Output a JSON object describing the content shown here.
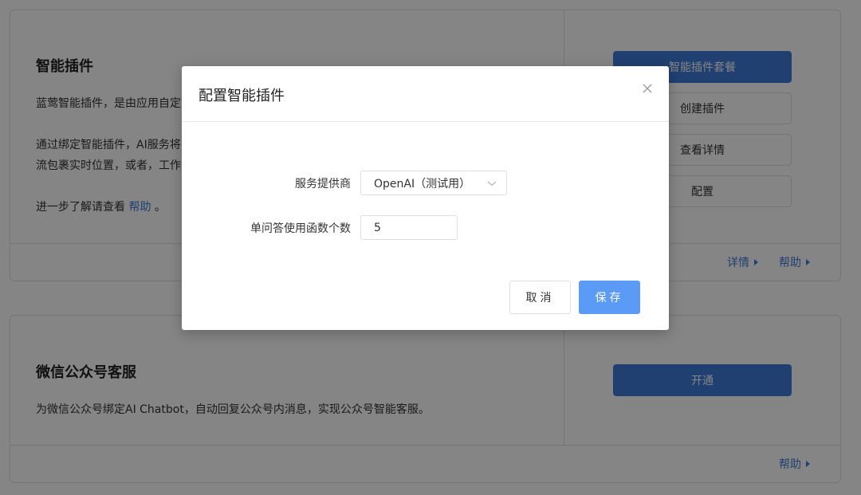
{
  "plugin_card": {
    "title": "智能插件",
    "desc_line1": "蓝莺智能插件，是由应用自定",
    "desc_line2": "通过绑定智能插件，AI服务将",
    "desc_line3": "流包裹实时位置，或者，工作",
    "desc_more_prefix": "进一步了解请查看 ",
    "desc_more_link": "帮助",
    "desc_more_suffix": " 。",
    "buttons": {
      "package": "智能插件套餐",
      "create": "创建插件",
      "details": "查看详情",
      "config": "配置"
    },
    "footer": {
      "details_link": "详情",
      "help_link": "帮助"
    }
  },
  "wechat_card": {
    "title": "微信公众号客服",
    "desc": "为微信公众号绑定AI Chatbot，自动回复公众号内消息，实现公众号智能客服。",
    "button": "开通",
    "footer": {
      "help_link": "帮助"
    }
  },
  "modal": {
    "title": "配置智能插件",
    "provider_label": "服务提供商",
    "provider_value": "OpenAI（测试用）",
    "func_count_label": "单问答使用函数个数",
    "func_count_value": "5",
    "cancel": "取消",
    "save": "保存"
  },
  "colors": {
    "primary": "#3d7bd9",
    "save_button": "#5b9bf5",
    "border": "#dcdfe6"
  }
}
